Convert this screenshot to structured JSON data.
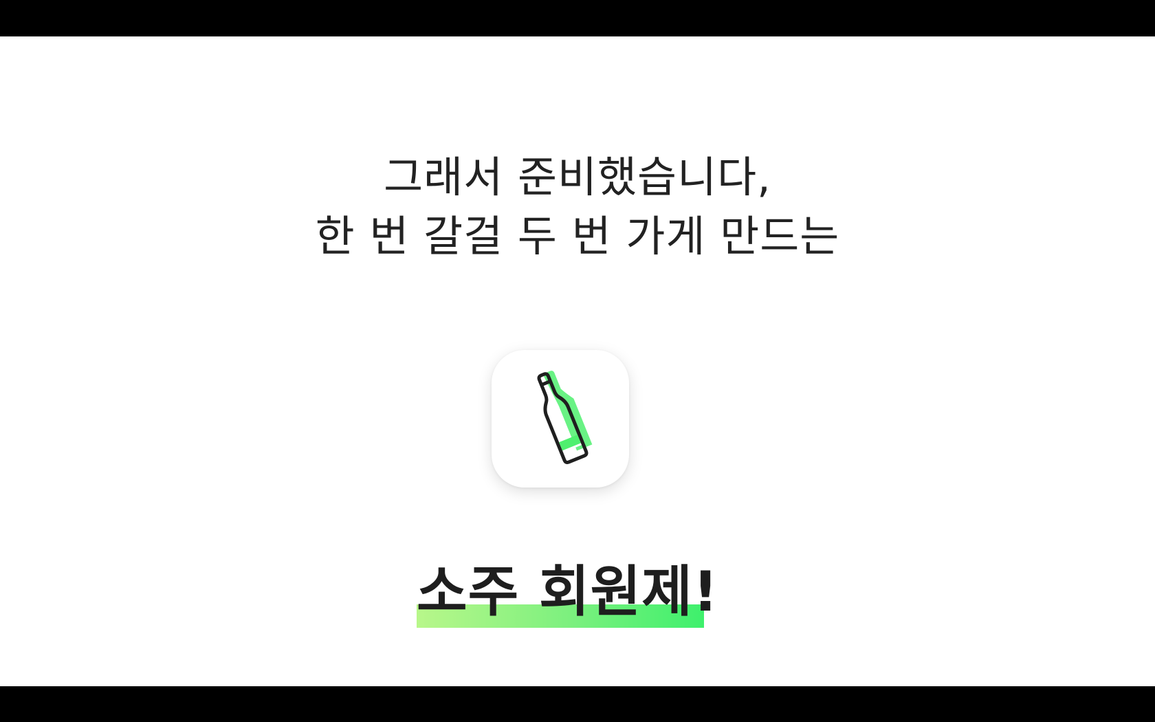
{
  "intro": {
    "line1": "그래서 준비했습니다,",
    "line2": "한 번 갈걸 두 번 가게 만드는"
  },
  "app_icon": {
    "icon": "soju-bottle-icon",
    "accent": "#4ff06f",
    "stroke": "#1f1f1f"
  },
  "title": {
    "text": "소주 회원제!",
    "highlight_from": "#b8f78a",
    "highlight_to": "#3ef06c"
  }
}
